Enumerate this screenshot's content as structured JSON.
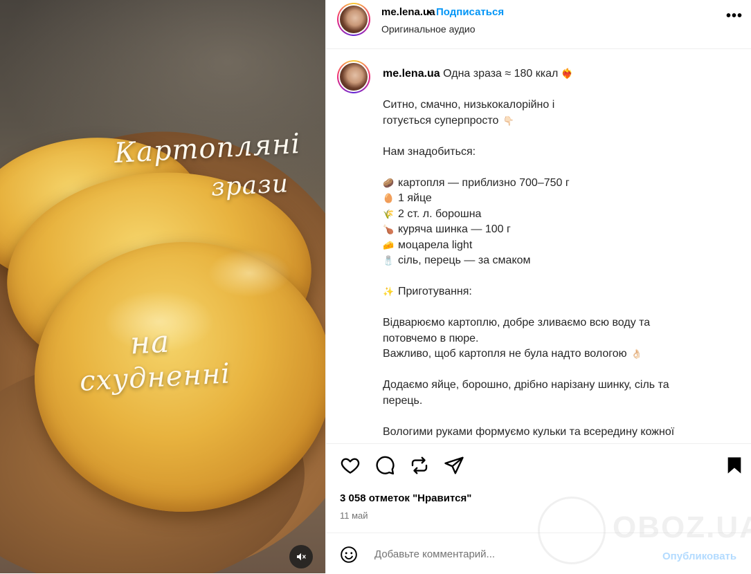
{
  "media": {
    "overlay_line1": "Картопляні",
    "overlay_line2": "зрази",
    "overlay_line3": "на",
    "overlay_line4": "схудненні",
    "mute_icon": "speaker-muted-icon"
  },
  "header": {
    "username": "me.lena.ua",
    "separator": "•",
    "follow_label": "Подписаться",
    "audio_label": "Оригинальное аудио",
    "more_label": "•••"
  },
  "caption": {
    "username": "me.lena.ua",
    "first_line": "Одна зраза ≈ 180 ккал",
    "first_line_emoji": "❤️‍🔥",
    "lines": [
      {
        "text": "Ситно, смачно, низькокалорійно і",
        "icon": ""
      },
      {
        "text": "готується суперпросто",
        "icon": "👇🏻",
        "icon_after": true
      },
      {
        "text": "",
        "icon": ""
      },
      {
        "text": "Нам знадобиться:",
        "icon": ""
      },
      {
        "text": "",
        "icon": ""
      },
      {
        "text": "картопля — приблизно 700–750 г",
        "icon": "🥔"
      },
      {
        "text": "1 яйце",
        "icon": "🥚"
      },
      {
        "text": "2 ст. л. борошна",
        "icon": "🌾"
      },
      {
        "text": "куряча шинка — 100 г",
        "icon": "🍗"
      },
      {
        "text": "моцарела light",
        "icon": "🧀"
      },
      {
        "text": "сіль, перець — за смаком",
        "icon": "🧂"
      },
      {
        "text": "",
        "icon": ""
      },
      {
        "text": "Приготування:",
        "icon": "✨"
      },
      {
        "text": "",
        "icon": ""
      },
      {
        "text": "Відварюємо картоплю, добре зливаємо всю воду та",
        "icon": ""
      },
      {
        "text": "потовчемо в пюре.",
        "icon": ""
      },
      {
        "text": "Важливо, щоб картопля не була надто вологою",
        "icon": "👌🏻",
        "icon_after": true
      },
      {
        "text": "",
        "icon": ""
      },
      {
        "text": "Додаємо яйце, борошно, дрібно нарізану шинку, сіль та",
        "icon": ""
      },
      {
        "text": "перець.",
        "icon": ""
      },
      {
        "text": "",
        "icon": ""
      },
      {
        "text": "Вологими руками формуємо кульки та всередину кожної",
        "icon": ""
      }
    ]
  },
  "actions": {
    "like_icon": "heart-icon",
    "comment_icon": "comment-icon",
    "repost_icon": "repost-icon",
    "share_icon": "send-icon",
    "save_icon": "bookmark-icon",
    "likes_text": "3 058 отметок \"Нравится\"",
    "date_text": "11 май"
  },
  "comment": {
    "placeholder": "Добавьте комментарий...",
    "post_label": "Опубликовать"
  },
  "watermark": {
    "text": "OBOZ.UA"
  }
}
